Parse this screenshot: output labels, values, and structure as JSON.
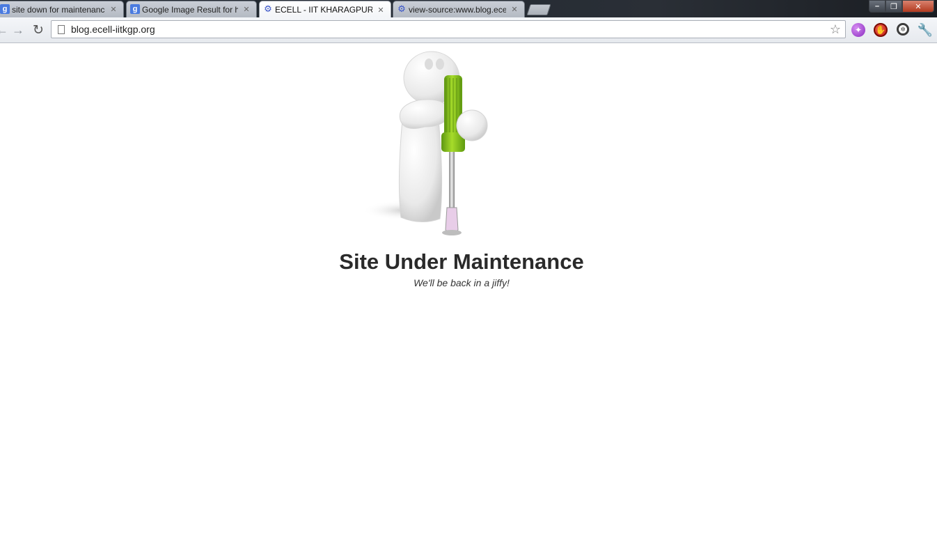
{
  "browser": {
    "tabs": [
      {
        "label": "site down for maintenance",
        "favicon": "google-g-icon",
        "favicon_char": "g",
        "active": false
      },
      {
        "label": "Google Image Result for ht",
        "favicon": "google-g-icon",
        "favicon_char": "g",
        "active": false
      },
      {
        "label": "ECELL - IIT KHARAGPUR",
        "favicon": "gear-icon",
        "favicon_char": "⚙",
        "active": true
      },
      {
        "label": "view-source:www.blog.ece",
        "favicon": "gear-icon",
        "favicon_char": "⚙",
        "active": false
      }
    ],
    "close_glyph": "✕",
    "window_controls": {
      "minimize": "–",
      "maximize": "❐",
      "close": "✕"
    },
    "nav": {
      "back": "←",
      "forward": "→",
      "reload": "↻"
    },
    "address": "blog.ecell-iitkgp.org",
    "star": "☆",
    "extensions": [
      {
        "name": "globe-extension-icon",
        "glyph": "✦"
      },
      {
        "name": "stop-extension-icon",
        "glyph": "✋"
      },
      {
        "name": "wheel-extension-icon",
        "glyph": "✲"
      },
      {
        "name": "wrench-menu-icon",
        "glyph": "🔧"
      }
    ],
    "colors": {
      "accent_green": "#8ec21f",
      "titlebar": "#1f252d"
    }
  },
  "page": {
    "heading": "Site Under Maintenance",
    "subheading": "We'll be back in a jiffy!"
  }
}
